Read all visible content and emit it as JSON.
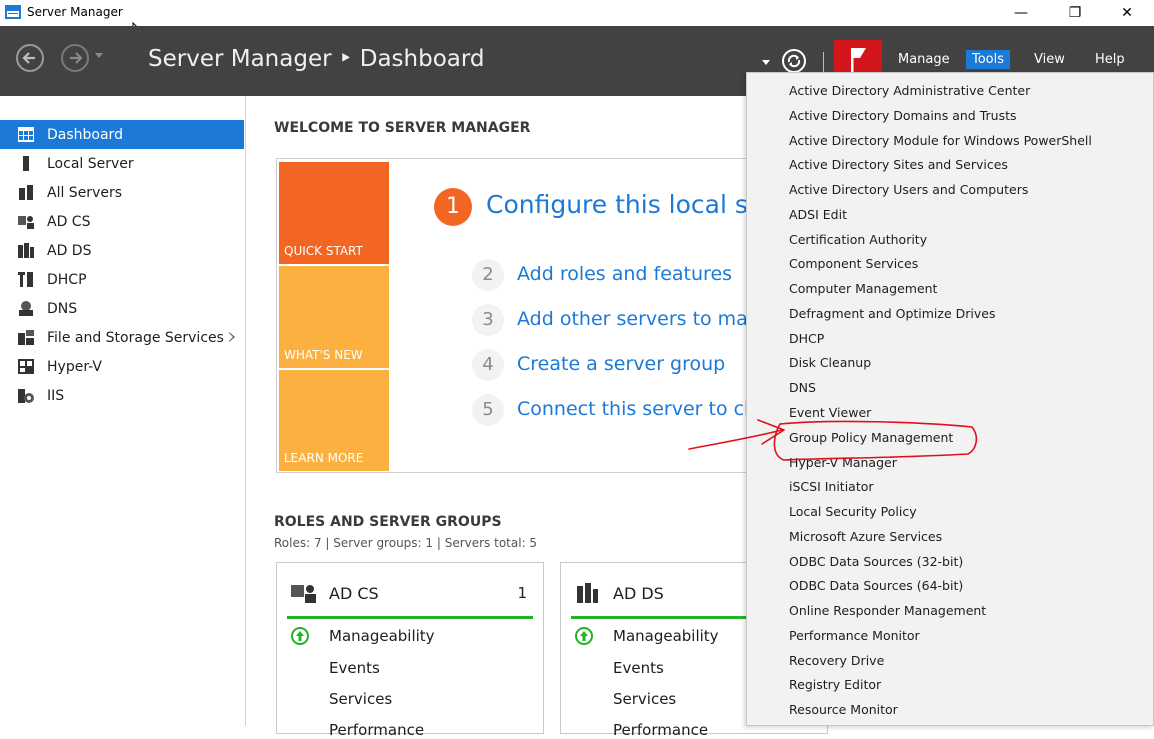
{
  "window": {
    "title": "Server Manager",
    "controls": {
      "minimize": "—",
      "maximize": "❐",
      "close": "✕"
    }
  },
  "header": {
    "title": "Server Manager ‣ Dashboard",
    "menu": [
      "Manage",
      "Tools",
      "View",
      "Help"
    ],
    "active_menu": "Tools",
    "flag_color": "#d3161b"
  },
  "sidebar": {
    "items": [
      {
        "label": "Dashboard",
        "icon": "dashboard-icon",
        "active": true
      },
      {
        "label": "Local Server",
        "icon": "local-server-icon"
      },
      {
        "label": "All Servers",
        "icon": "all-servers-icon"
      },
      {
        "label": "AD CS",
        "icon": "ad-cs-icon"
      },
      {
        "label": "AD DS",
        "icon": "ad-ds-icon"
      },
      {
        "label": "DHCP",
        "icon": "dhcp-icon"
      },
      {
        "label": "DNS",
        "icon": "dns-icon"
      },
      {
        "label": "File and Storage Services",
        "icon": "file-storage-icon",
        "expandable": true
      },
      {
        "label": "Hyper-V",
        "icon": "hyper-v-icon"
      },
      {
        "label": "IIS",
        "icon": "iis-icon"
      }
    ]
  },
  "welcome": {
    "title": "WELCOME TO SERVER MANAGER",
    "tiles": [
      "QUICK START",
      "WHAT'S NEW",
      "LEARN MORE"
    ],
    "steps": [
      {
        "num": "1",
        "text": "Configure this local server"
      },
      {
        "num": "2",
        "text": "Add roles and features"
      },
      {
        "num": "3",
        "text": "Add other servers to manage"
      },
      {
        "num": "4",
        "text": "Create a server group"
      },
      {
        "num": "5",
        "text": "Connect this server to cloud services"
      }
    ]
  },
  "roles": {
    "title": "ROLES AND SERVER GROUPS",
    "summary": "Roles: 7  |  Server groups: 1  |  Servers total: 5",
    "cards": [
      {
        "title": "AD CS",
        "count": "1",
        "rows": [
          "Manageability",
          "Events",
          "Services",
          "Performance"
        ]
      },
      {
        "title": "AD DS",
        "count": "",
        "rows": [
          "Manageability",
          "Events",
          "Services",
          "Performance"
        ]
      }
    ],
    "status_color": "#26b226"
  },
  "tools_menu": {
    "items": [
      "Active Directory Administrative Center",
      "Active Directory Domains and Trusts",
      "Active Directory Module for Windows PowerShell",
      "Active Directory Sites and Services",
      "Active Directory Users and Computers",
      "ADSI Edit",
      "Certification Authority",
      "Component Services",
      "Computer Management",
      "Defragment and Optimize Drives",
      "DHCP",
      "Disk Cleanup",
      "DNS",
      "Event Viewer",
      "Group Policy Management",
      "Hyper-V Manager",
      "iSCSI Initiator",
      "Local Security Policy",
      "Microsoft Azure Services",
      "ODBC Data Sources (32-bit)",
      "ODBC Data Sources (64-bit)",
      "Online Responder Management",
      "Performance Monitor",
      "Recovery Drive",
      "Registry Editor",
      "Resource Monitor"
    ],
    "highlighted": "Group Policy Management",
    "annotation_color": "#e0101a"
  },
  "colors": {
    "header_bg": "#424242",
    "accent": "#1c79d6",
    "quick_start": "#f26522",
    "tile_yellow": "#fbb040"
  }
}
